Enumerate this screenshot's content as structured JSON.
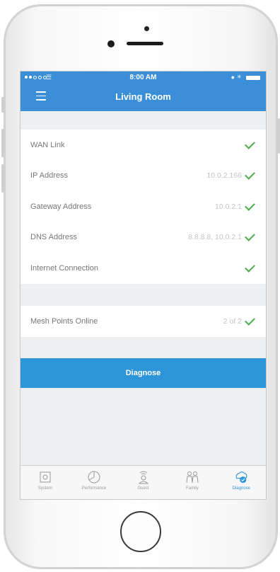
{
  "status_bar": {
    "time": "8:00 AM"
  },
  "header": {
    "title": "Living Room"
  },
  "diagnostics": [
    {
      "label": "WAN Link",
      "value": ""
    },
    {
      "label": "IP Address",
      "value": "10.0.2.166"
    },
    {
      "label": "Gateway Address",
      "value": "10.0.2.1"
    },
    {
      "label": "DNS Address",
      "value": "8.8.8.8, 10.0.2.1"
    },
    {
      "label": "Internet Connection",
      "value": ""
    }
  ],
  "mesh": {
    "label": "Mesh Points Online",
    "value": "2 of 2"
  },
  "diagnose_button": "Diagnose",
  "tabs": [
    {
      "label": "System",
      "icon": "system-icon"
    },
    {
      "label": "Performance",
      "icon": "performance-icon"
    },
    {
      "label": "Guest",
      "icon": "guest-icon"
    },
    {
      "label": "Family",
      "icon": "family-icon"
    },
    {
      "label": "Diagnose",
      "icon": "diagnose-icon",
      "active": true
    }
  ],
  "colors": {
    "accent": "#3a8fd8",
    "button": "#2f95d9",
    "check": "#4cae4c"
  }
}
